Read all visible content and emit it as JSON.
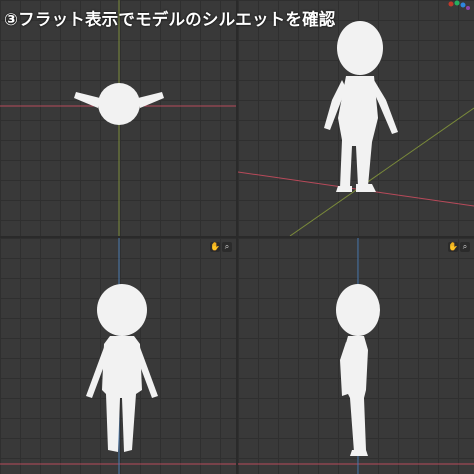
{
  "caption": "③フラット表示でモデルのシルエットを確認",
  "colors": {
    "background": "#393939",
    "grid": "#2f2f2f",
    "axis_x": "#b84a5a",
    "axis_y": "#7a8a3a",
    "axis_z": "#4a7ab0",
    "silhouette": "#f2f2f2"
  },
  "viewports": [
    {
      "name": "top-view",
      "icons": []
    },
    {
      "name": "perspective-view",
      "icons": []
    },
    {
      "name": "front-view",
      "icons": [
        "hand-icon",
        "zoom-icon"
      ]
    },
    {
      "name": "side-view",
      "icons": [
        "hand-icon",
        "zoom-icon"
      ]
    }
  ],
  "gizmo": {
    "icons": [
      "axis-gizmo-icon"
    ]
  }
}
